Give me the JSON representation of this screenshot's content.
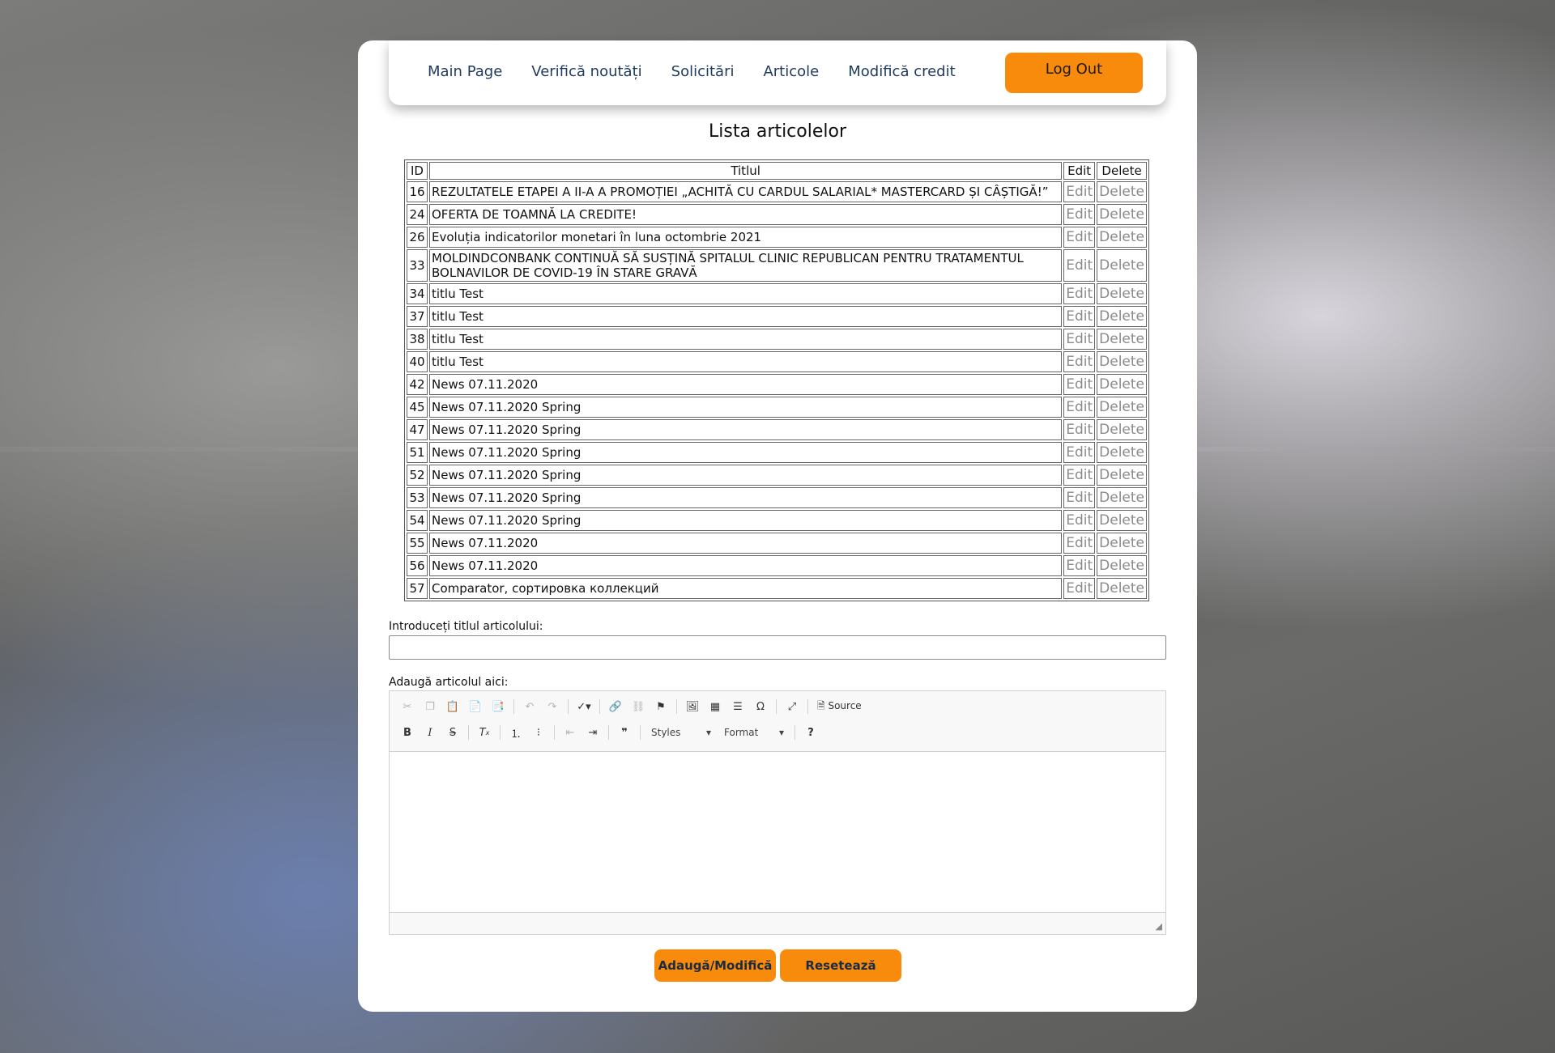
{
  "nav": {
    "links": [
      "Main Page",
      "Verifică noutăți",
      "Solicitări",
      "Articole",
      "Modifică credit"
    ],
    "logout": "Log Out"
  },
  "page_title": "Lista articolelor",
  "table": {
    "headers": [
      "ID",
      "Titlul",
      "Edit",
      "Delete"
    ],
    "edit_label": "Edit",
    "delete_label": "Delete",
    "rows": [
      {
        "id": "16",
        "title": "REZULTATELE ETAPEI A II-A A PROMOȚIEI „ACHITĂ CU CARDUL SALARIAL* MASTERCARD ȘI CÂȘTIGĂ!”"
      },
      {
        "id": "24",
        "title": "OFERTA DE TOAMNĂ LA CREDITE!"
      },
      {
        "id": "26",
        "title": "Evoluția indicatorilor monetari în luna octombrie 2021"
      },
      {
        "id": "33",
        "title": "MOLDINDCONBANK CONTINUĂ SĂ SUSȚINĂ SPITALUL CLINIC REPUBLICAN PENTRU TRATAMENTUL BOLNAVILOR DE COVID-19 ÎN STARE GRAVĂ"
      },
      {
        "id": "34",
        "title": "titlu Test"
      },
      {
        "id": "37",
        "title": "titlu Test"
      },
      {
        "id": "38",
        "title": "titlu Test"
      },
      {
        "id": "40",
        "title": "titlu Test"
      },
      {
        "id": "42",
        "title": "News 07.11.2020"
      },
      {
        "id": "45",
        "title": "News 07.11.2020 Spring"
      },
      {
        "id": "47",
        "title": "News 07.11.2020 Spring"
      },
      {
        "id": "51",
        "title": "News 07.11.2020 Spring"
      },
      {
        "id": "52",
        "title": "News 07.11.2020 Spring"
      },
      {
        "id": "53",
        "title": "News 07.11.2020 Spring"
      },
      {
        "id": "54",
        "title": "News 07.11.2020 Spring"
      },
      {
        "id": "55",
        "title": "News 07.11.2020"
      },
      {
        "id": "56",
        "title": "News 07.11.2020"
      },
      {
        "id": "57",
        "title": "Comparator, сортировка коллекций"
      }
    ]
  },
  "form": {
    "title_label": "Introduceți titlul articolului:",
    "title_value": "",
    "article_label": "Adaugă articolul aici:"
  },
  "editor": {
    "source_label": "Source",
    "styles_label": "Styles",
    "format_label": "Format"
  },
  "buttons": {
    "submit": "Adaugă/Modifică",
    "reset": "Resetează"
  },
  "colors": {
    "accent": "#f98b0c",
    "nav_text": "#1f3a5c"
  }
}
